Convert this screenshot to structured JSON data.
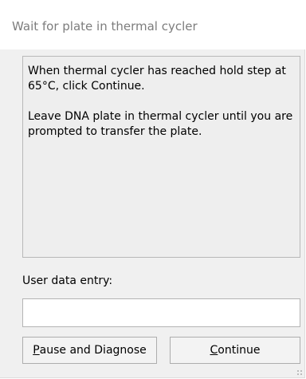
{
  "window": {
    "title": "Wait for plate in thermal cycler"
  },
  "message": {
    "paragraphs": [
      "When thermal cycler has reached hold step at 65°C, click Continue.",
      "Leave DNA plate in thermal cycler until you are prompted to transfer the plate."
    ]
  },
  "user_entry": {
    "label": "User data entry:",
    "value": "",
    "placeholder": ""
  },
  "buttons": {
    "pause": {
      "accelerator": "P",
      "rest": "ause and Diagnose"
    },
    "continue": {
      "accelerator": "C",
      "rest": "ontinue"
    }
  },
  "colors": {
    "dialog_background": "#f0f0f0",
    "title_background": "#ffffff",
    "title_text": "#7d7d7d",
    "panel_border": "#b8b8b8",
    "button_face": "#f3f3f3"
  },
  "icons": {
    "resize_grip": "resize-grip-icon"
  }
}
